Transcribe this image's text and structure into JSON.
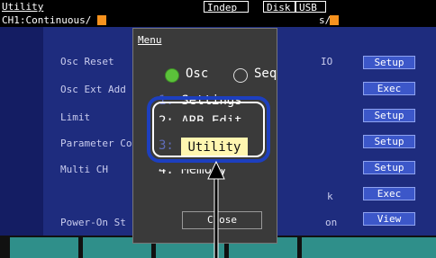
{
  "topbar": {
    "title": "Utility",
    "indep": "Indep",
    "disk": "Disk",
    "usb": "USB"
  },
  "channel": {
    "left_status": "CH1:Continuous/",
    "right_status": "s/"
  },
  "rows": {
    "osc_reset": "Osc Reset",
    "osc_ext_add": "Osc Ext Add",
    "limit": "Limit",
    "parameter": "Parameter Co",
    "multi_ch": "Multi CH",
    "power_on": "Power-On St"
  },
  "right_labels": {
    "io": "IO",
    "k": "k",
    "on": "on"
  },
  "buttons": [
    "Setup",
    "Exec",
    "Setup",
    "Setup",
    "Setup",
    "Exec",
    "View"
  ],
  "menu": {
    "title": "Menu",
    "radio_osc": "Osc",
    "radio_seq": "Seq",
    "osc_selected": true,
    "item1_num": "1:",
    "item1_text": "Settings",
    "item2_text": "2: ARB Edit",
    "item3_num": "3:",
    "item3_text": "Utility",
    "item4_text": "4: Memory",
    "close": "Close"
  },
  "colors": {
    "panel": "#1e2c7e",
    "button": "#3c57c9",
    "highlight": "#fff6b0",
    "selected_radio": "#5bc23a",
    "callout": "#1d3fbf",
    "orange_tag": "#f7921e",
    "softkey": "#2f8f8a"
  }
}
